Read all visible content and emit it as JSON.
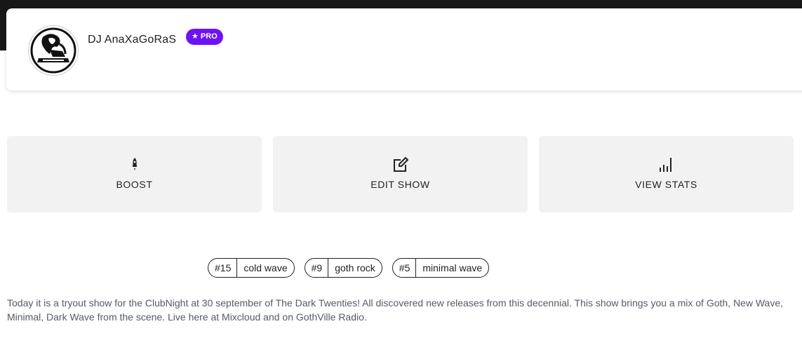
{
  "profile": {
    "name": "DJ AnaXaGoRaS",
    "badge": "★ PRO",
    "avatar_icon": "dj-avatar-icon"
  },
  "actions": [
    {
      "label": "BOOST",
      "icon": "rocket-icon"
    },
    {
      "label": "EDIT SHOW",
      "icon": "edit-icon"
    },
    {
      "label": "VIEW STATS",
      "icon": "bar-chart-icon"
    }
  ],
  "tags": [
    {
      "rank": "#15",
      "genre": "cold wave"
    },
    {
      "rank": "#9",
      "genre": "goth rock"
    },
    {
      "rank": "#5",
      "genre": "minimal wave"
    }
  ],
  "description": "Today it is a tryout show for the ClubNight at 30 september of The Dark Twenties! All discovered new releases from this decennial. This show brings you a mix of Goth, New Wave, Minimal, Dark Wave from the scene. Live here at Mixcloud and on GothVille Radio.",
  "colors": {
    "pro_badge": "#6e12f5",
    "button_bg": "#f2f2f2",
    "topbar": "#171717"
  }
}
